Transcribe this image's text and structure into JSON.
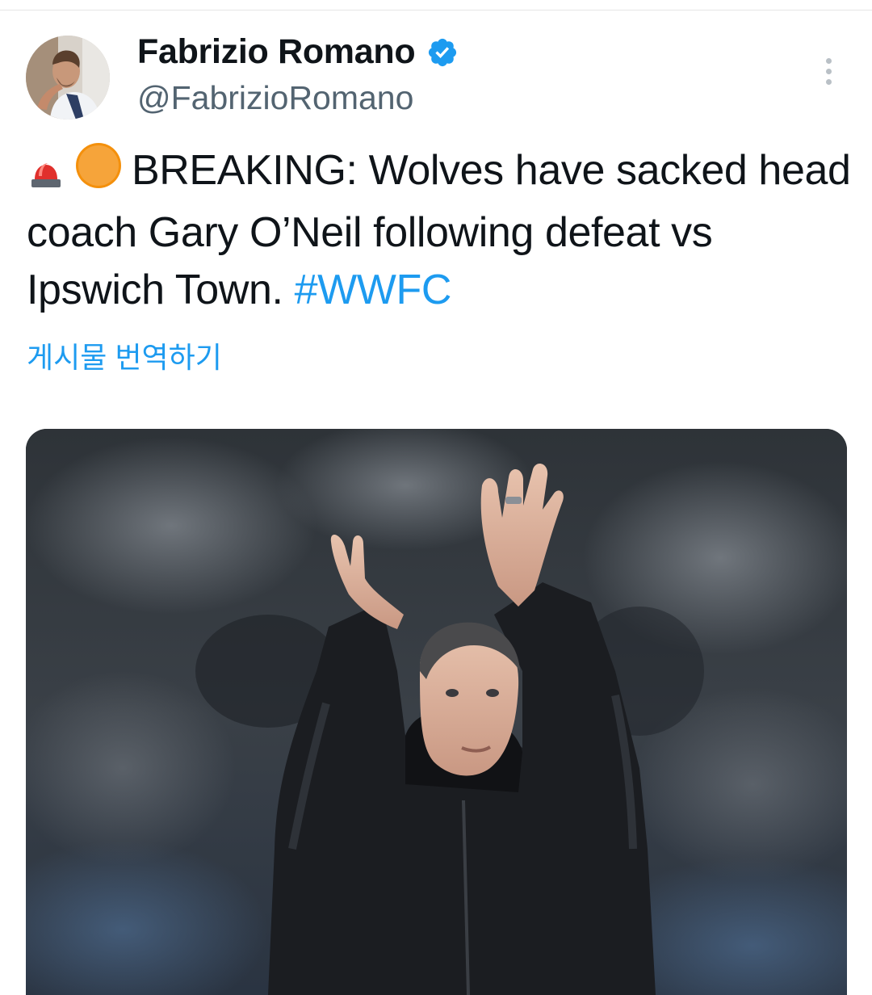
{
  "author": {
    "display_name": "Fabrizio Romano",
    "handle": "@FabrizioRomano",
    "verified": true,
    "avatar_icon": "profile-photo"
  },
  "menu": {
    "icon": "more-vertical-icon"
  },
  "tweet": {
    "text_main": "BREAKING: Wolves have sacked head coach Gary O’Neil following defeat vs Ipswich Town.",
    "hashtag": "#WWFC",
    "emojis": [
      "rotating-light-emoji",
      "orange-circle-emoji"
    ],
    "translate_label": "게시물 번역하기"
  },
  "colors": {
    "accent": "#1d9bf0",
    "text": "#0f1419",
    "secondary": "#536471"
  }
}
